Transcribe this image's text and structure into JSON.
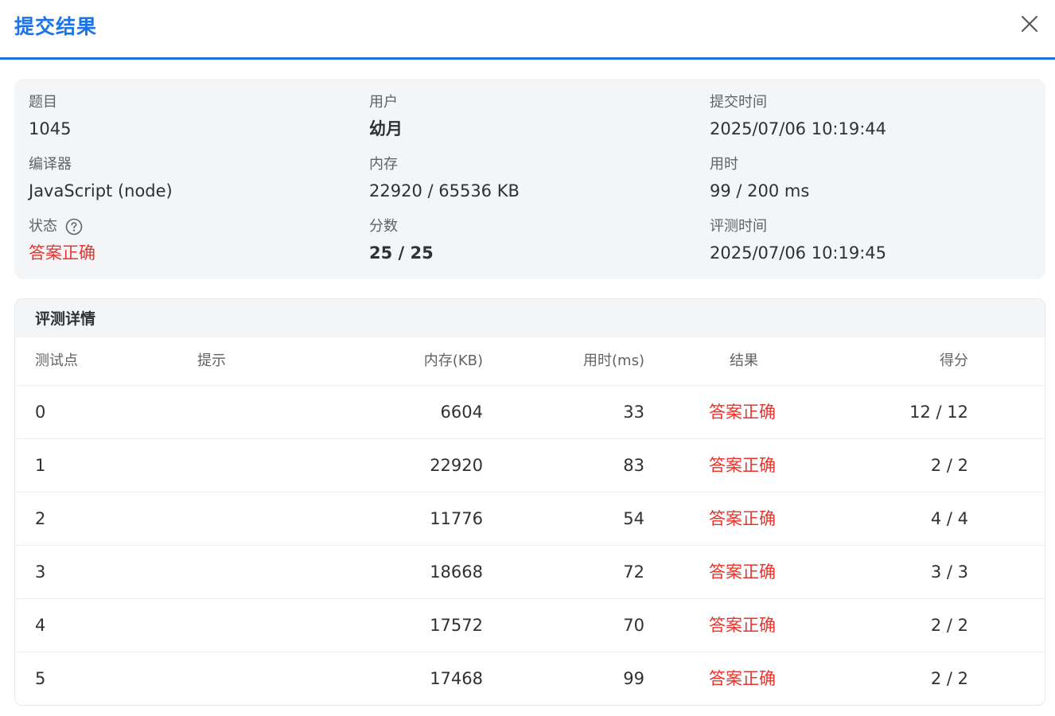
{
  "dialog": {
    "title": "提交结果"
  },
  "info": {
    "problem_label": "题目",
    "problem_value": "1045",
    "user_label": "用户",
    "user_value": "幼月",
    "submit_time_label": "提交时间",
    "submit_time_value": "2025/07/06 10:19:44",
    "compiler_label": "编译器",
    "compiler_value": "JavaScript (node)",
    "memory_label": "内存",
    "memory_value": "22920 / 65536 KB",
    "time_label": "用时",
    "time_value": "99 / 200 ms",
    "status_label": "状态",
    "status_value": "答案正确",
    "score_label": "分数",
    "score_value": "25 / 25",
    "judge_time_label": "评测时间",
    "judge_time_value": "2025/07/06 10:19:45"
  },
  "details": {
    "title": "评测详情",
    "columns": {
      "case": "测试点",
      "hint": "提示",
      "memory": "内存(KB)",
      "time": "用时(ms)",
      "result": "结果",
      "score": "得分"
    },
    "rows": [
      {
        "case": "0",
        "hint": "",
        "memory": "6604",
        "time": "33",
        "result": "答案正确",
        "score": "12 / 12"
      },
      {
        "case": "1",
        "hint": "",
        "memory": "22920",
        "time": "83",
        "result": "答案正确",
        "score": "2 / 2"
      },
      {
        "case": "2",
        "hint": "",
        "memory": "11776",
        "time": "54",
        "result": "答案正确",
        "score": "4 / 4"
      },
      {
        "case": "3",
        "hint": "",
        "memory": "18668",
        "time": "72",
        "result": "答案正确",
        "score": "3 / 3"
      },
      {
        "case": "4",
        "hint": "",
        "memory": "17572",
        "time": "70",
        "result": "答案正确",
        "score": "2 / 2"
      },
      {
        "case": "5",
        "hint": "",
        "memory": "17468",
        "time": "99",
        "result": "答案正确",
        "score": "2 / 2"
      }
    ]
  },
  "colors": {
    "accent": "#1a73e8",
    "status_success": "#e8342c"
  }
}
